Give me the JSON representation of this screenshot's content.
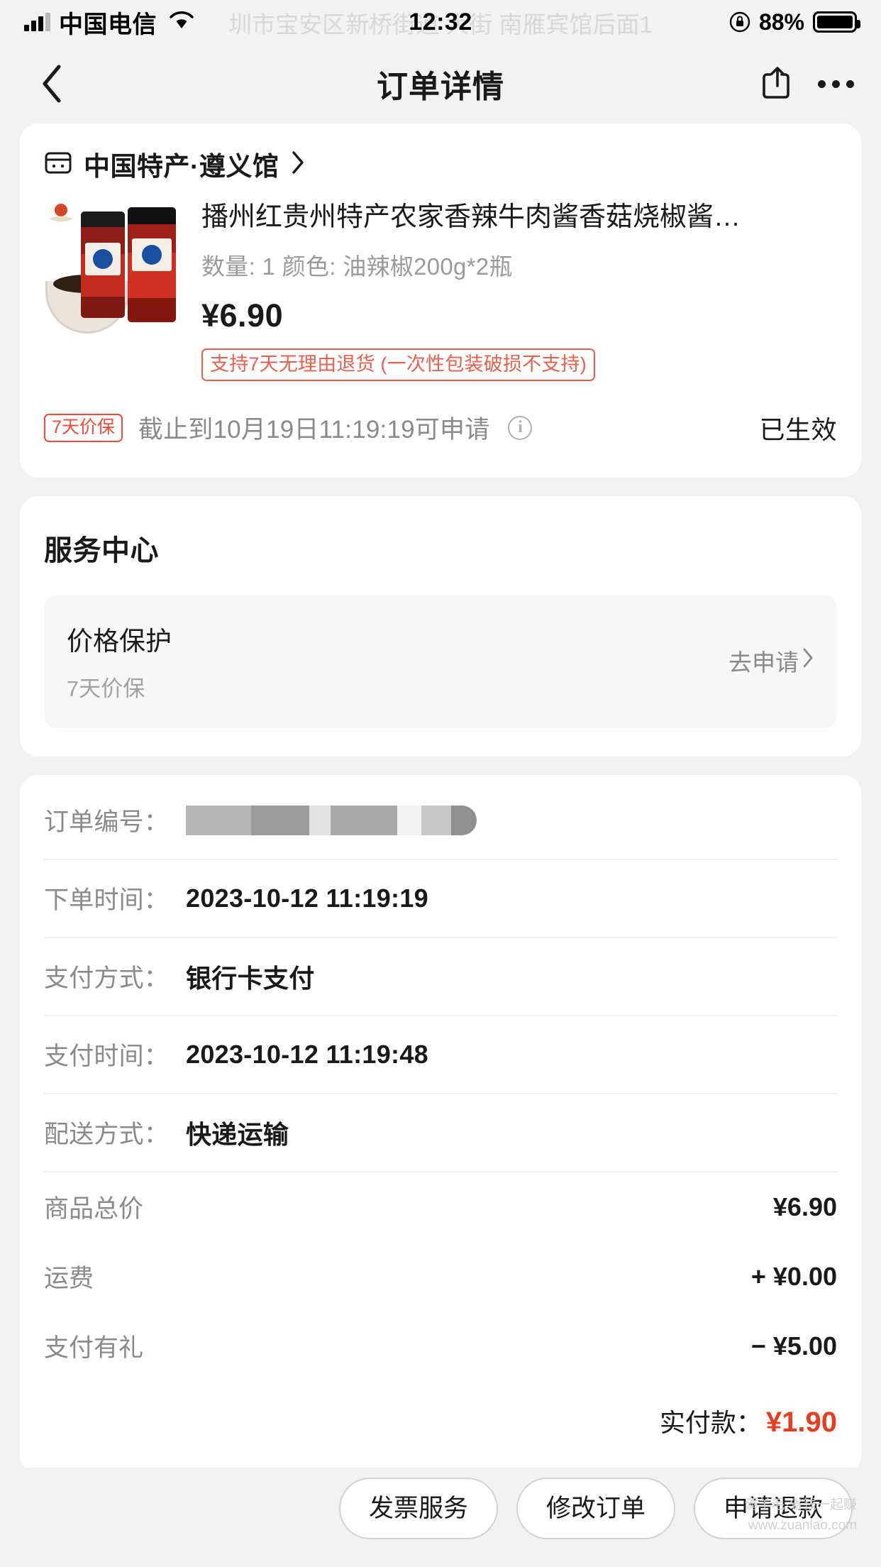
{
  "status_bar": {
    "carrier": "中国电信",
    "time": "12:32",
    "battery_percent": "88%",
    "watermark": "圳市宝安区新桥街道    大街 南雁宾馆后面1"
  },
  "nav": {
    "title": "订单详情",
    "back_icon": "chevron-left-icon",
    "share_icon": "share-icon",
    "more_icon": "more-icon"
  },
  "shop": {
    "name": "中国特产·遵义馆",
    "chevron": "›"
  },
  "product": {
    "title": "播州红贵州特产农家香辣牛肉酱香菇烧椒酱…",
    "spec": "数量: 1   颜色: 油辣椒200g*2瓶",
    "price": "¥6.90",
    "return_policy": "支持7天无理由退货 (一次性包装破损不支持)"
  },
  "price_protect": {
    "badge": "7天价保",
    "text": "截止到10月19日11:19:19可申请",
    "info_icon": "info-icon",
    "status": "已生效"
  },
  "service_center": {
    "title": "服务中心",
    "items": [
      {
        "title": "价格保护",
        "subtitle": "7天价保",
        "action": "去申请",
        "chevron": "›"
      }
    ]
  },
  "order_info": {
    "rows": [
      {
        "label": "订单编号：",
        "value": "",
        "redacted": true
      },
      {
        "label": "下单时间：",
        "value": "2023-10-12 11:19:19",
        "redacted": false
      },
      {
        "label": "支付方式：",
        "value": "银行卡支付",
        "redacted": false
      },
      {
        "label": "支付时间：",
        "value": "2023-10-12 11:19:48",
        "redacted": false
      },
      {
        "label": "配送方式：",
        "value": "快递运输",
        "redacted": false
      }
    ],
    "summary": [
      {
        "label": "商品总价",
        "value": "¥6.90"
      },
      {
        "label": "运费",
        "value": "+ ¥0.00"
      },
      {
        "label": "支付有礼",
        "value": "− ¥5.00"
      }
    ],
    "total_label": "实付款：",
    "total_value": "¥1.90"
  },
  "bottom_bar": {
    "buttons": [
      {
        "label": "发票服务"
      },
      {
        "label": "修改订单"
      },
      {
        "label": "申请退款"
      }
    ],
    "watermark_line1": "薅羊毛·省钱一起赚",
    "watermark_line2": "www.zuanlao.com"
  },
  "colors": {
    "accent_red": "#e83b20",
    "badge_red": "#ef4a3a",
    "return_red": "#e8604c",
    "page_bg": "#f2f2f2",
    "card_bg": "#ffffff",
    "muted_text": "#8a8a8a"
  }
}
